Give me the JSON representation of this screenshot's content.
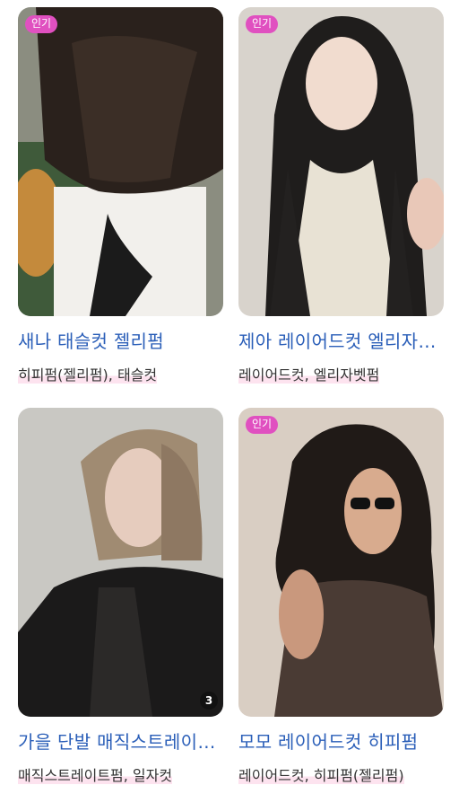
{
  "cards": [
    {
      "title": "새나 태슬컷 젤리펌",
      "tags": "히피펌(젤리펌), 태슬컷",
      "badge": "인기",
      "image_count": ""
    },
    {
      "title": "제아 레이어드컷 엘리자벳펌",
      "tags": "레이어드컷, 엘리자벳펌",
      "badge": "인기",
      "image_count": ""
    },
    {
      "title": "가을 단발 매직스트레이트펌",
      "tags": "매직스트레이트펌, 일자컷",
      "badge": "",
      "image_count": "3"
    },
    {
      "title": "모모 레이어드컷 히피펌",
      "tags": "레이어드컷, 히피펌(젤리펌)",
      "badge": "인기",
      "image_count": ""
    }
  ],
  "colors": {
    "badge": "#e050c0",
    "title": "#2a5eb8",
    "tag_highlight": "#fde3ef"
  }
}
